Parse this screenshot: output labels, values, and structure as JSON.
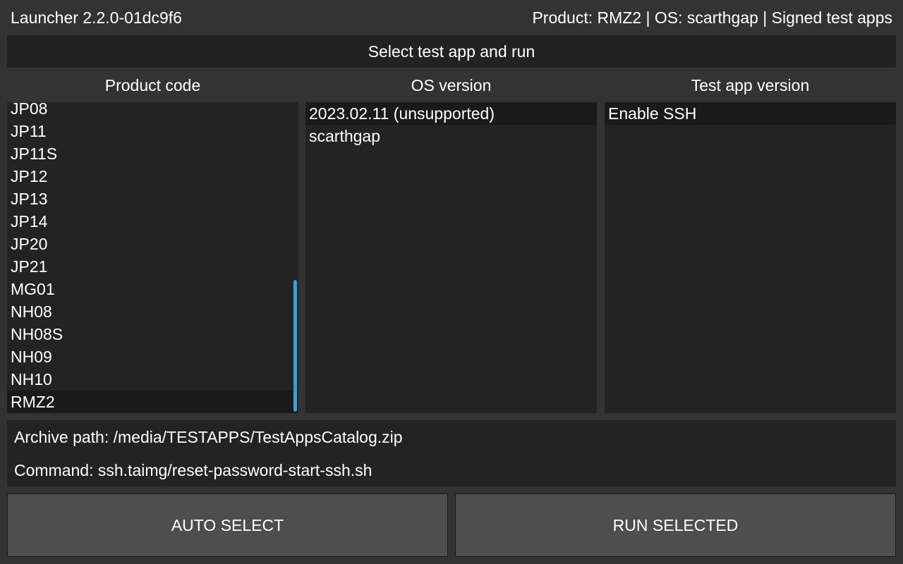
{
  "header": {
    "app_version": "Launcher 2.2.0-01dc9f6",
    "status": "Product: RMZ2 | OS: scarthgap | Signed test apps"
  },
  "title": "Select test app and run",
  "columns": {
    "product_code": {
      "header": "Product code",
      "items": [
        "JP08",
        "JP11",
        "JP11S",
        "JP12",
        "JP13",
        "JP14",
        "JP20",
        "JP21",
        "MG01",
        "NH08",
        "NH08S",
        "NH09",
        "NH10",
        "RMZ2"
      ],
      "selected": "RMZ2"
    },
    "os_version": {
      "header": "OS version",
      "items": [
        "2023.02.11 (unsupported)",
        "scarthgap"
      ],
      "selected": "2023.02.11 (unsupported)"
    },
    "test_app_version": {
      "header": "Test app version",
      "items": [
        "Enable SSH"
      ],
      "selected": "Enable SSH"
    }
  },
  "info": {
    "archive_path": "Archive path: /media/TESTAPPS/TestAppsCatalog.zip",
    "command": "Command: ssh.taimg/reset-password-start-ssh.sh"
  },
  "buttons": {
    "auto_select": "AUTO SELECT",
    "run_selected": "RUN SELECTED"
  },
  "colors": {
    "background": "#333333",
    "panel": "#232323",
    "selected_row": "#1a1a1a",
    "button": "#4e4e4e",
    "scrollbar": "#3c9fd1"
  }
}
